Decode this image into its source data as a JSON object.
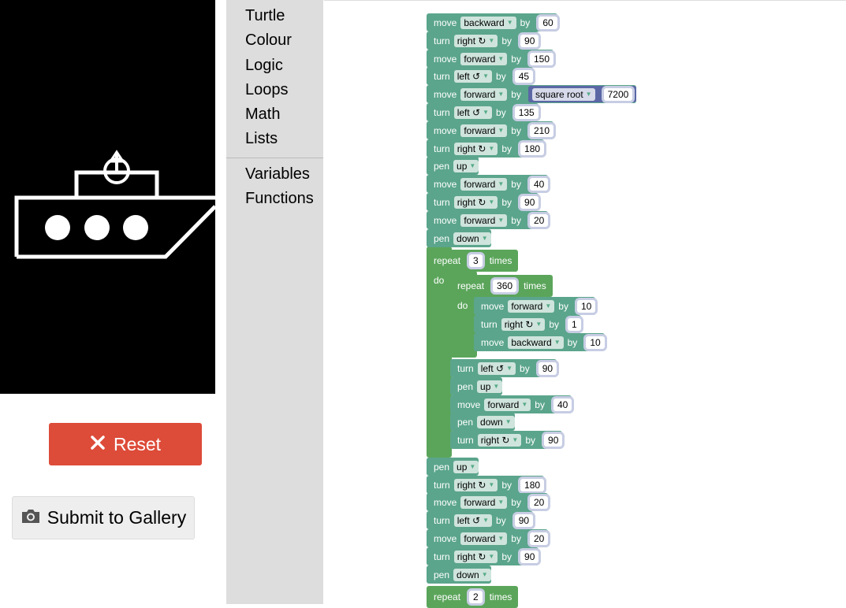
{
  "toolbox": {
    "categories": [
      "Turtle",
      "Colour",
      "Logic",
      "Loops",
      "Math",
      "Lists"
    ],
    "categories2": [
      "Variables",
      "Functions"
    ]
  },
  "buttons": {
    "reset_label": "Reset",
    "gallery_label": "Submit to Gallery"
  },
  "icons": {
    "reset": "close-icon",
    "gallery": "camera-icon"
  },
  "colors": {
    "turtle_block": "#5ba58c",
    "loop_block": "#5ba55b",
    "math_block": "#5b67a5",
    "reset_button": "#dd4b39"
  },
  "blocks": [
    {
      "kw": "move",
      "opt": "backward",
      "by": "by",
      "val": "60"
    },
    {
      "kw": "turn",
      "opt": "right ↻",
      "by": "by",
      "val": "90"
    },
    {
      "kw": "move",
      "opt": "forward",
      "by": "by",
      "val": "150"
    },
    {
      "kw": "turn",
      "opt": "left ↺",
      "by": "by",
      "val": "45"
    },
    {
      "kw": "move",
      "opt": "forward",
      "by": "by",
      "fn": "square root",
      "val": "7200"
    },
    {
      "kw": "turn",
      "opt": "left ↺",
      "by": "by",
      "val": "135"
    },
    {
      "kw": "move",
      "opt": "forward",
      "by": "by",
      "val": "210"
    },
    {
      "kw": "turn",
      "opt": "right ↻",
      "by": "by",
      "val": "180"
    },
    {
      "kw": "pen",
      "opt": "up"
    },
    {
      "kw": "move",
      "opt": "forward",
      "by": "by",
      "val": "40"
    },
    {
      "kw": "turn",
      "opt": "right ↻",
      "by": "by",
      "val": "90"
    },
    {
      "kw": "move",
      "opt": "forward",
      "by": "by",
      "val": "20"
    },
    {
      "kw": "pen",
      "opt": "down"
    },
    {
      "kw": "repeat",
      "val": "3",
      "suffix": "times",
      "do": "do"
    },
    {
      "kw": "repeat",
      "val": "360",
      "suffix": "times",
      "do": "do"
    },
    {
      "kw": "move",
      "opt": "forward",
      "by": "by",
      "val": "10"
    },
    {
      "kw": "turn",
      "opt": "right ↻",
      "by": "by",
      "val": "1"
    },
    {
      "kw": "move",
      "opt": "backward",
      "by": "by",
      "val": "10"
    },
    {
      "kw": "turn",
      "opt": "left ↺",
      "by": "by",
      "val": "90"
    },
    {
      "kw": "pen",
      "opt": "up"
    },
    {
      "kw": "move",
      "opt": "forward",
      "by": "by",
      "val": "40"
    },
    {
      "kw": "pen",
      "opt": "down"
    },
    {
      "kw": "turn",
      "opt": "right ↻",
      "by": "by",
      "val": "90"
    },
    {
      "kw": "pen",
      "opt": "up"
    },
    {
      "kw": "turn",
      "opt": "right ↻",
      "by": "by",
      "val": "180"
    },
    {
      "kw": "move",
      "opt": "forward",
      "by": "by",
      "val": "20"
    },
    {
      "kw": "turn",
      "opt": "left ↺",
      "by": "by",
      "val": "90"
    },
    {
      "kw": "move",
      "opt": "forward",
      "by": "by",
      "val": "20"
    },
    {
      "kw": "turn",
      "opt": "right ↻",
      "by": "by",
      "val": "90"
    },
    {
      "kw": "pen",
      "opt": "down"
    },
    {
      "kw": "repeat",
      "val": "2",
      "suffix": "times"
    }
  ]
}
